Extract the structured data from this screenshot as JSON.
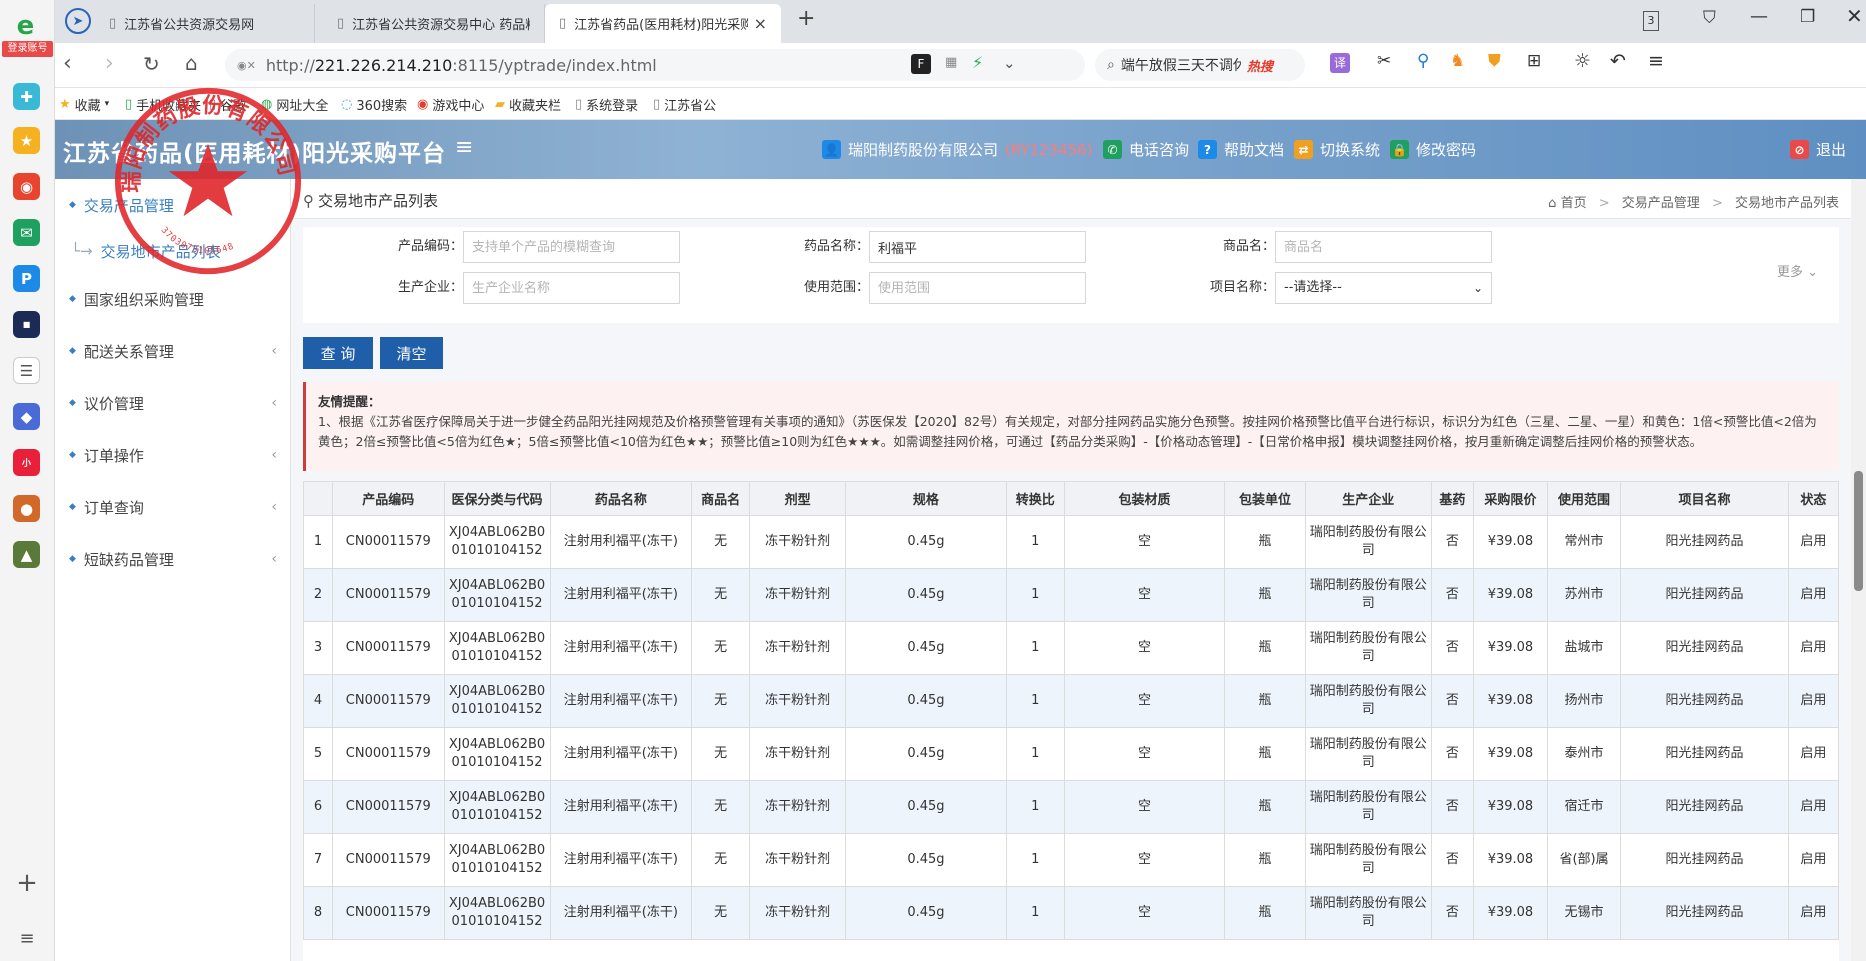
{
  "leftbar": {
    "login_label": "登录账号",
    "add_label": "+",
    "menu_label": "≡"
  },
  "tabs": [
    {
      "label": "江苏省公共资源交易网"
    },
    {
      "label": "江苏省公共资源交易中心 药品料"
    },
    {
      "label": "江苏省药品(医用耗材)阳光采购平"
    }
  ],
  "tab_close": "×",
  "tab_add": "+",
  "tab_count": "3",
  "address": {
    "prefix": "http://",
    "host": "221.226.214.210",
    "rest": ":8115/yptrade/index.html",
    "search_text": "端午放假三天不调休",
    "search_badge": "热搜"
  },
  "bookmarks": [
    {
      "label": "收藏"
    },
    {
      "label": "手机收藏夹"
    },
    {
      "label": "谷歌"
    },
    {
      "label": "网址大全"
    },
    {
      "label": "360搜索"
    },
    {
      "label": "游戏中心"
    },
    {
      "label": "收藏夹栏"
    },
    {
      "label": "系统登录"
    },
    {
      "label": "江苏省公"
    }
  ],
  "header": {
    "title": "江苏省药品(医用耗材)阳光采购平台",
    "company": "瑞阳制药股份有限公司",
    "company_code": "(RY123456)",
    "phone": "电话咨询",
    "help": "帮助文档",
    "switch": "切换系统",
    "password": "修改密码",
    "logout": "退出"
  },
  "sidebar": {
    "items": [
      {
        "label": "交易产品管理"
      },
      {
        "label": "交易地市产品列表"
      },
      {
        "label": "国家组织采购管理"
      },
      {
        "label": "配送关系管理"
      },
      {
        "label": "议价管理"
      },
      {
        "label": "订单操作"
      },
      {
        "label": "订单查询"
      },
      {
        "label": "短缺药品管理"
      }
    ]
  },
  "breadcrumb": {
    "page_title": "交易地市产品列表",
    "home": "首页",
    "level1": "交易产品管理",
    "level2": "交易地市产品列表",
    "sep": ">"
  },
  "form": {
    "product_code_label": "产品编码：",
    "product_code_placeholder": "支持单个产品的模糊查询",
    "drug_name_label": "药品名称：",
    "drug_name_value": "利福平",
    "trade_name_label": "商品名：",
    "trade_name_placeholder": "商品名",
    "manufacturer_label": "生产企业：",
    "manufacturer_placeholder": "生产企业名称",
    "scope_label": "使用范围：",
    "scope_placeholder": "使用范围",
    "project_label": "项目名称：",
    "project_value": "--请选择--",
    "more": "更多",
    "query_btn": "查 询",
    "clear_btn": "清空"
  },
  "notice": {
    "title": "友情提醒：",
    "text": "1、根据《江苏省医疗保障局关于进一步健全药品阳光挂网规范及价格预警管理有关事项的通知》（苏医保发【2020】82号）有关规定，对部分挂网药品实施分色预警。按挂网价格预警比值平台进行标识，标识分为红色（三星、二星、一星）和黄色：1倍<预警比值<2倍为黄色；2倍≤预警比值<5倍为红色★；5倍≤预警比值<10倍为红色★★；预警比值≥10则为红色★★★。如需调整挂网价格，可通过【药品分类采购】-【价格动态管理】-【日常价格申报】模块调整挂网价格，按月重新确定调整后挂网价格的预警状态。"
  },
  "table": {
    "headers": [
      "",
      "产品编码",
      "医保分类与代码",
      "药品名称",
      "商品名",
      "剂型",
      "规格",
      "转换比",
      "包装材质",
      "包装单位",
      "生产企业",
      "基药",
      "采购限价",
      "使用范围",
      "项目名称",
      "状态"
    ],
    "rows": [
      [
        "1",
        "CN00011579",
        "XJ04ABL062B001010104152",
        "注射用利福平(冻干)",
        "无",
        "冻干粉针剂",
        "0.45g",
        "1",
        "空",
        "瓶",
        "瑞阳制药股份有限公司",
        "否",
        "¥39.08",
        "常州市",
        "阳光挂网药品",
        "启用"
      ],
      [
        "2",
        "CN00011579",
        "XJ04ABL062B001010104152",
        "注射用利福平(冻干)",
        "无",
        "冻干粉针剂",
        "0.45g",
        "1",
        "空",
        "瓶",
        "瑞阳制药股份有限公司",
        "否",
        "¥39.08",
        "苏州市",
        "阳光挂网药品",
        "启用"
      ],
      [
        "3",
        "CN00011579",
        "XJ04ABL062B001010104152",
        "注射用利福平(冻干)",
        "无",
        "冻干粉针剂",
        "0.45g",
        "1",
        "空",
        "瓶",
        "瑞阳制药股份有限公司",
        "否",
        "¥39.08",
        "盐城市",
        "阳光挂网药品",
        "启用"
      ],
      [
        "4",
        "CN00011579",
        "XJ04ABL062B001010104152",
        "注射用利福平(冻干)",
        "无",
        "冻干粉针剂",
        "0.45g",
        "1",
        "空",
        "瓶",
        "瑞阳制药股份有限公司",
        "否",
        "¥39.08",
        "扬州市",
        "阳光挂网药品",
        "启用"
      ],
      [
        "5",
        "CN00011579",
        "XJ04ABL062B001010104152",
        "注射用利福平(冻干)",
        "无",
        "冻干粉针剂",
        "0.45g",
        "1",
        "空",
        "瓶",
        "瑞阳制药股份有限公司",
        "否",
        "¥39.08",
        "泰州市",
        "阳光挂网药品",
        "启用"
      ],
      [
        "6",
        "CN00011579",
        "XJ04ABL062B001010104152",
        "注射用利福平(冻干)",
        "无",
        "冻干粉针剂",
        "0.45g",
        "1",
        "空",
        "瓶",
        "瑞阳制药股份有限公司",
        "否",
        "¥39.08",
        "宿迁市",
        "阳光挂网药品",
        "启用"
      ],
      [
        "7",
        "CN00011579",
        "XJ04ABL062B001010104152",
        "注射用利福平(冻干)",
        "无",
        "冻干粉针剂",
        "0.45g",
        "1",
        "空",
        "瓶",
        "瑞阳制药股份有限公司",
        "否",
        "¥39.08",
        "省(部)属",
        "阳光挂网药品",
        "启用"
      ],
      [
        "8",
        "CN00011579",
        "XJ04ABL062B001010104152",
        "注射用利福平(冻干)",
        "无",
        "冻干粉针剂",
        "0.45g",
        "1",
        "空",
        "瓶",
        "瑞阳制药股份有限公司",
        "否",
        "¥39.08",
        "无锡市",
        "阳光挂网药品",
        "启用"
      ]
    ]
  },
  "stamp": {
    "text": "瑞阳制药股份有限公司",
    "number": "3703073105648"
  },
  "colors": {
    "primary": "#1f5ea8",
    "notice_border": "#cd3b3b",
    "stamp_red": "#e0262a",
    "company_code": "#ff7b7b"
  }
}
